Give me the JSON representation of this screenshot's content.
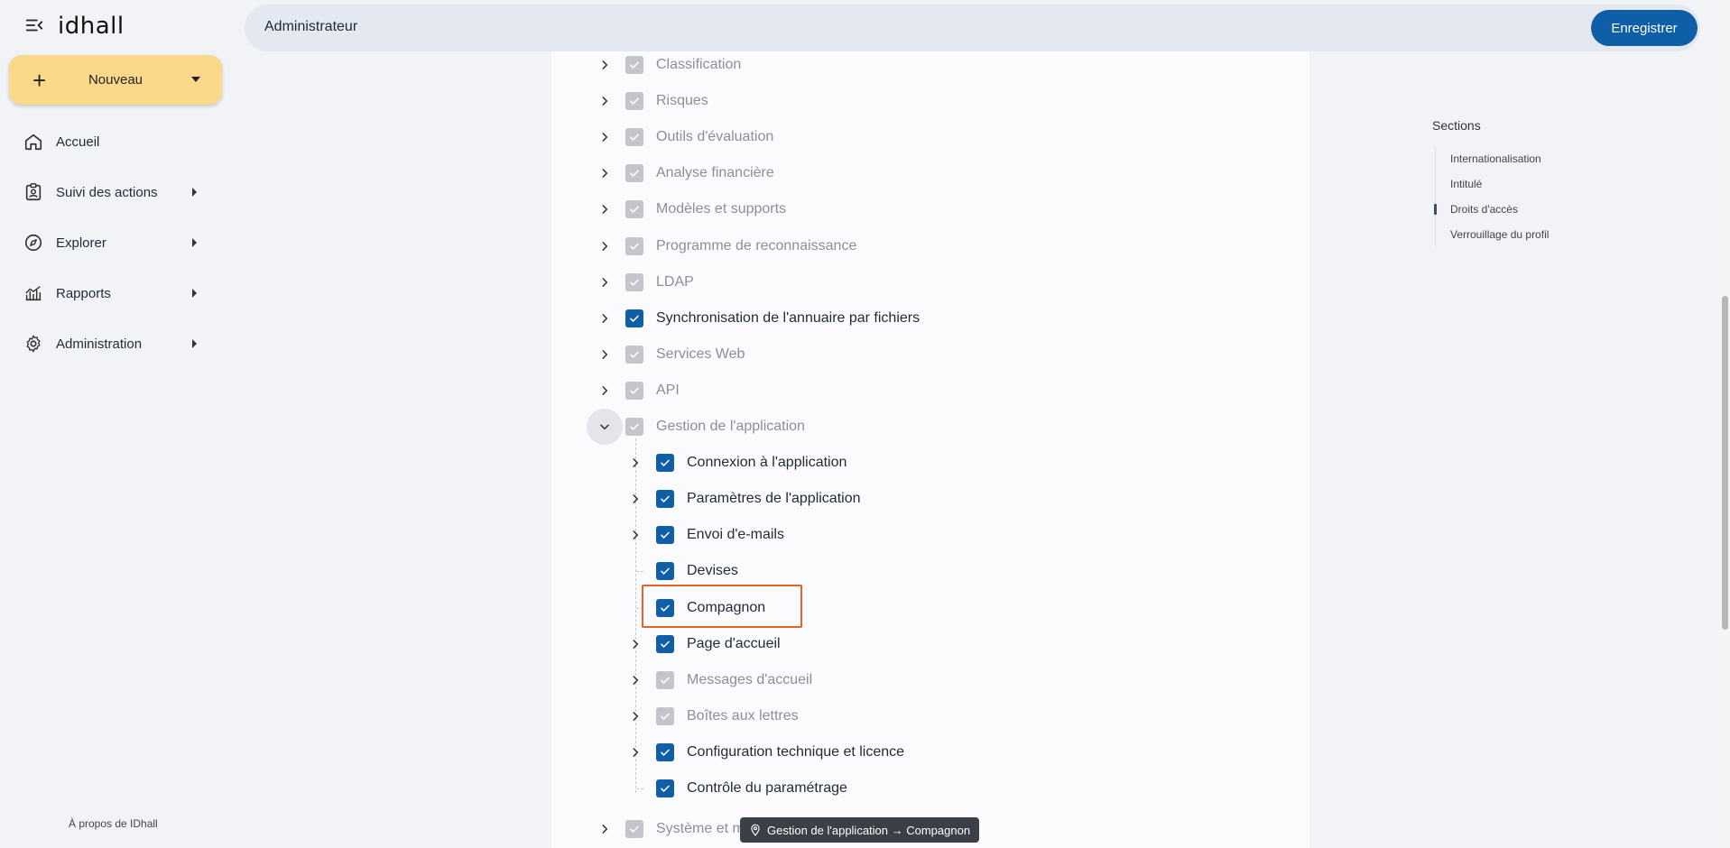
{
  "app": {
    "logo_text": "idhall",
    "menu_icon": "collapse-menu-icon"
  },
  "sidebar": {
    "new_button": "Nouveau",
    "items": [
      {
        "label": "Accueil",
        "icon": "home-icon",
        "has_submenu": false
      },
      {
        "label": "Suivi des actions",
        "icon": "clipboard-user-icon",
        "has_submenu": true
      },
      {
        "label": "Explorer",
        "icon": "compass-icon",
        "has_submenu": true
      },
      {
        "label": "Rapports",
        "icon": "chart-icon",
        "has_submenu": true
      },
      {
        "label": "Administration",
        "icon": "gear-icon",
        "has_submenu": true
      }
    ],
    "about": "À propos de IDhall"
  },
  "header": {
    "title": "Administrateur",
    "save_label": "Enregistrer"
  },
  "tree": {
    "top_rows": [
      {
        "label": "Classification",
        "checked": "partial"
      },
      {
        "label": "Risques",
        "checked": "partial"
      },
      {
        "label": "Outils d'évaluation",
        "checked": "partial"
      },
      {
        "label": "Analyse financière",
        "checked": "partial"
      },
      {
        "label": "Modèles et supports",
        "checked": "partial"
      },
      {
        "label": "Programme de reconnaissance",
        "checked": "partial"
      },
      {
        "label": "LDAP",
        "checked": "partial"
      },
      {
        "label": "Synchronisation de l'annuaire par fichiers",
        "checked": "full"
      },
      {
        "label": "Services Web",
        "checked": "partial"
      },
      {
        "label": "API",
        "checked": "partial"
      },
      {
        "label": "Gestion de l'application",
        "checked": "partial",
        "expanded": true
      }
    ],
    "children": [
      {
        "label": "Connexion à l'application",
        "checked": "full",
        "expandable": true
      },
      {
        "label": "Paramètres de l'application",
        "checked": "full",
        "expandable": true
      },
      {
        "label": "Envoi d'e-mails",
        "checked": "full",
        "expandable": true
      },
      {
        "label": "Devises",
        "checked": "full",
        "expandable": false
      },
      {
        "label": "Compagnon",
        "checked": "full",
        "expandable": false,
        "highlighted": true
      },
      {
        "label": "Page d'accueil",
        "checked": "full",
        "expandable": true
      },
      {
        "label": "Messages d'accueil",
        "checked": "partial",
        "expandable": true
      },
      {
        "label": "Boîtes aux lettres",
        "checked": "partial",
        "expandable": true
      },
      {
        "label": "Configuration technique et licence",
        "checked": "full",
        "expandable": true
      },
      {
        "label": "Contrôle du paramétrage",
        "checked": "full",
        "expandable": false
      }
    ],
    "bottom_row": {
      "label": "Système et m",
      "checked": "partial"
    }
  },
  "tooltip": {
    "text": "Gestion de l'application → Compagnon",
    "icon": "location-pin-icon"
  },
  "sections": {
    "title": "Sections",
    "items": [
      {
        "label": "Internationalisation",
        "active": false
      },
      {
        "label": "Intitulé",
        "active": false
      },
      {
        "label": "Droits d'accès",
        "active": true
      },
      {
        "label": "Verrouillage du profil",
        "active": false
      }
    ]
  },
  "colors": {
    "accent": "#0f5ea8",
    "new_button": "#fbd98b",
    "highlight": "#e8641e"
  }
}
